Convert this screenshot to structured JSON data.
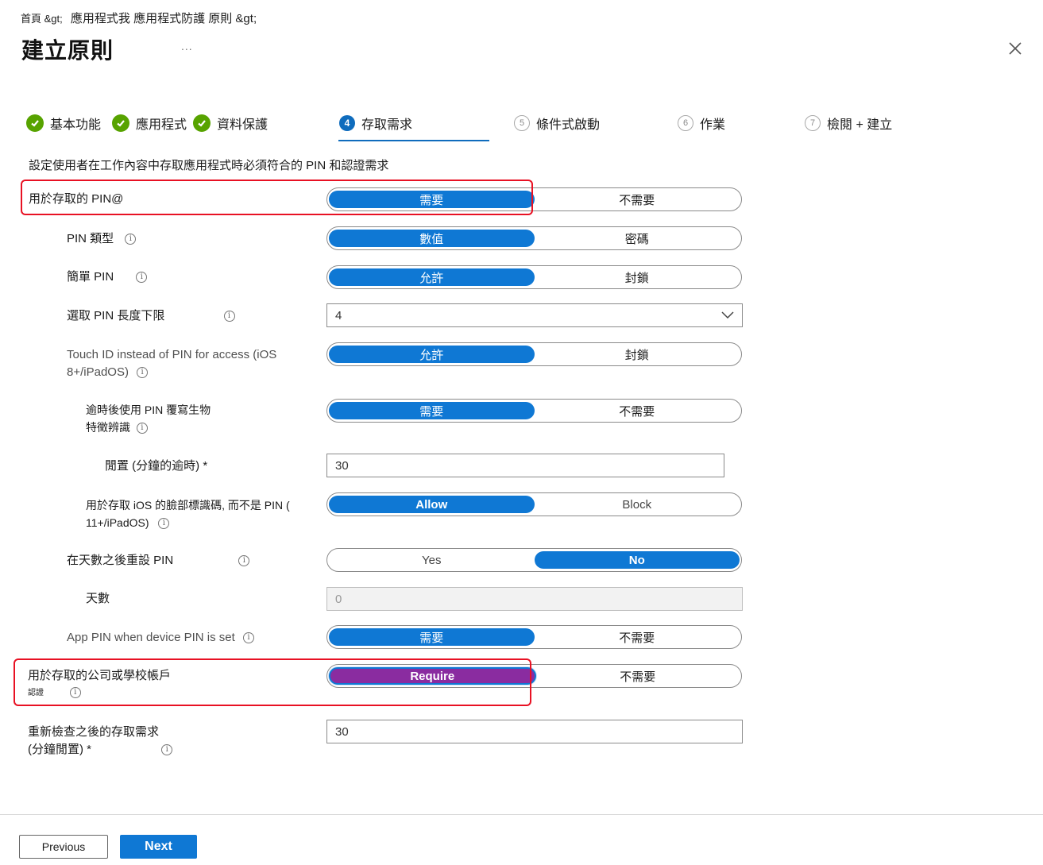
{
  "breadcrumb": {
    "home": "首頁 &gt;",
    "path": "應用程式我 應用程式防護 原則 &gt;"
  },
  "page": {
    "title": "建立原則",
    "more": "..."
  },
  "steps": [
    {
      "number": "1",
      "label": "基本功能",
      "status": "done"
    },
    {
      "number": "2",
      "label": "應用程式",
      "status": "done"
    },
    {
      "number": "3",
      "label": "資料保護",
      "status": "done"
    },
    {
      "number": "4",
      "label": "存取需求",
      "status": "current"
    },
    {
      "number": "5",
      "label": "條件式啟動",
      "status": "todo"
    },
    {
      "number": "6",
      "label": "作業",
      "status": "todo"
    },
    {
      "number": "7",
      "label": "檢閱 + 建立",
      "status": "todo"
    }
  ],
  "description": "設定使用者在工作內容中存取應用程式時必須符合的 PIN 和認證需求",
  "settings": {
    "pin_for_access": {
      "label": "用於存取的 PIN@",
      "options": [
        "需要",
        "不需要"
      ],
      "selected": "需要"
    },
    "pin_type": {
      "label": "PIN 類型",
      "options": [
        "數值",
        "密碼"
      ],
      "selected": "數值"
    },
    "simple_pin": {
      "label": "簡單 PIN",
      "options": [
        "允許",
        "封鎖"
      ],
      "selected": "允許"
    },
    "min_pin_length": {
      "label": "選取 PIN 長度下限",
      "value": "4"
    },
    "touch_id": {
      "label_line1": "Touch ID instead of PIN for access (iOS",
      "label_line2": "8+/iPadOS)",
      "options": [
        "允許",
        "封鎖"
      ],
      "selected": "允許"
    },
    "override_biometrics": {
      "label_line1": "逾時後使用 PIN 覆寫生物",
      "label_line2": "特徵辨識",
      "options": [
        "需要",
        "不需要"
      ],
      "selected": "需要"
    },
    "timeout": {
      "label": "閒置 (分鐘的逾時) *",
      "value": "30"
    },
    "face_id": {
      "label_line1": "用於存取 iOS 的臉部標識碼, 而不是 PIN (",
      "label_line2": "11+/iPadOS)",
      "options": [
        "Allow",
        "Block"
      ],
      "selected": "Allow"
    },
    "pin_reset": {
      "label": "在天數之後重設 PIN",
      "options": [
        "Yes",
        "No"
      ],
      "selected": "No"
    },
    "days": {
      "label": "天數",
      "value": "0"
    },
    "app_pin_device_pin": {
      "label": "App PIN when device PIN is set",
      "options": [
        "需要",
        "不需要"
      ],
      "selected": "需要"
    },
    "work_account_creds": {
      "label_line1": "用於存取的公司或學校帳戶",
      "label_line2": "認證",
      "options": [
        "Require",
        "不需要"
      ],
      "selected": "Require"
    },
    "recheck": {
      "label_line1": "重新檢查之後的存取需求",
      "label_line2": "(分鐘閒置) *",
      "value": "30"
    }
  },
  "icons": {
    "info": "i",
    "close": "close-icon",
    "check": "check-icon",
    "chevron": "chevron-down-icon"
  },
  "footer": {
    "previous": "Previous",
    "next": "Next"
  },
  "colors": {
    "accent": "#0f78d4",
    "success": "#57a300",
    "highlight": "#e81123",
    "selected_purple": "#8a2ca0"
  }
}
